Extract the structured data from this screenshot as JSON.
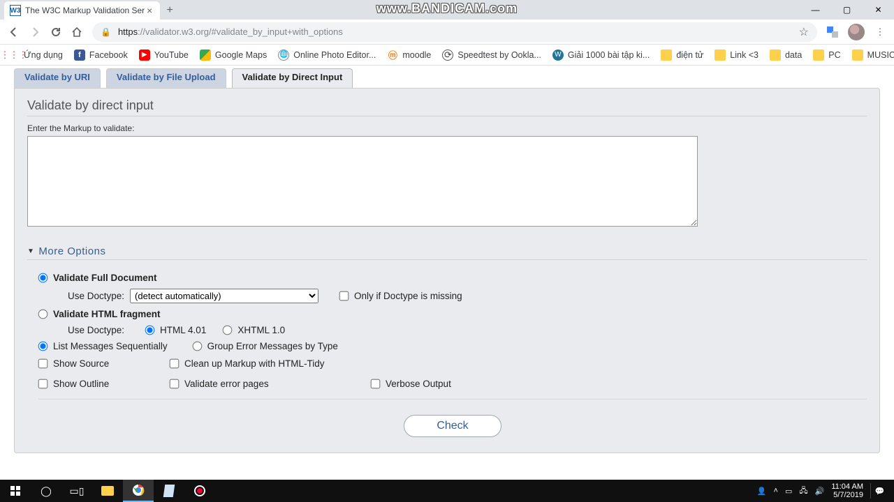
{
  "watermark": "www.BANDICAM.com",
  "browser": {
    "tab_title": "The W3C Markup Validation Ser",
    "url_secure_prefix": "https",
    "url_rest": "://validator.w3.org/#validate_by_input+with_options",
    "window_min": "—",
    "window_max": "▢",
    "window_close": "✕"
  },
  "bookmarks": [
    {
      "label": "Ứng dụng"
    },
    {
      "label": "Facebook"
    },
    {
      "label": "YouTube"
    },
    {
      "label": "Google Maps"
    },
    {
      "label": "Online Photo Editor..."
    },
    {
      "label": "moodle"
    },
    {
      "label": "Speedtest by Ookla..."
    },
    {
      "label": "Giải 1000 bài tập ki..."
    },
    {
      "label": "điện tử"
    },
    {
      "label": "Link <3"
    },
    {
      "label": "data"
    },
    {
      "label": "PC"
    },
    {
      "label": "MUSIC"
    }
  ],
  "page_tabs": {
    "uri": "Validate by URI",
    "upload": "Validate by File Upload",
    "direct": "Validate by Direct Input"
  },
  "heading": "Validate by direct input",
  "markup_label": "Enter the Markup to validate:",
  "more_options": "More Options",
  "opts": {
    "validate_full": "Validate Full Document",
    "use_doctype": "Use Doctype:",
    "doctype_auto": "(detect automatically)",
    "only_missing": "Only if Doctype is missing",
    "validate_fragment": "Validate HTML fragment",
    "html401": "HTML 4.01",
    "xhtml10": "XHTML 1.0",
    "list_seq": "List Messages Sequentially",
    "group_type": "Group Error Messages by Type",
    "show_source": "Show Source",
    "tidy": "Clean up Markup with HTML-Tidy",
    "show_outline": "Show Outline",
    "validate_error": "Validate error pages",
    "verbose": "Verbose Output"
  },
  "check_button": "Check",
  "taskbar": {
    "time": "11:04 AM",
    "date": "5/7/2019"
  }
}
